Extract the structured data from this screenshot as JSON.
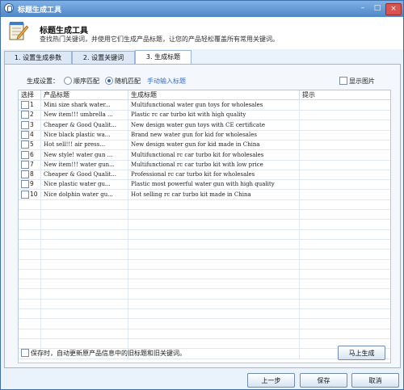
{
  "window": {
    "title": "标题生成工具"
  },
  "titlebar_buttons": {
    "minimize": "–",
    "maximize": "□",
    "close": "×"
  },
  "header": {
    "title": "标题生成工具",
    "subtitle": "查找热门关键词，并使用它们生成产品标题，让您的产品轻松覆盖所有常用关键词。"
  },
  "tabs": [
    {
      "label": "1. 设置生成参数",
      "active": false
    },
    {
      "label": "2. 设置关键词",
      "active": false
    },
    {
      "label": "3. 生成标题",
      "active": true
    }
  ],
  "settings": {
    "label": "生成设置：",
    "option_sequential": "顺序匹配",
    "option_random": "随机匹配",
    "selected": "random",
    "manual_link": "手动输入标题",
    "show_image": "显示图片"
  },
  "table": {
    "headers": [
      "选择",
      "产品标题",
      "生成标题",
      "提示"
    ],
    "rows": [
      {
        "num": "1",
        "product": "Mini size shark water...",
        "generated": "Multifunctional water gun toys for wholesales"
      },
      {
        "num": "2",
        "product": "New item!!! umbrella ...",
        "generated": "Plastic rc car turbo kit with high quality"
      },
      {
        "num": "3",
        "product": "Cheaper & Good Qualit...",
        "generated": "New design water gun toys with CE certificate"
      },
      {
        "num": "4",
        "product": "Nice black plastic wa...",
        "generated": "Brand new water gun for kid for wholesales"
      },
      {
        "num": "5",
        "product": "Hot sell!!! air press...",
        "generated": "New design water gun for kid made in China"
      },
      {
        "num": "6",
        "product": "New style! water gun ...",
        "generated": "Multifunctional rc car turbo kit for wholesales"
      },
      {
        "num": "7",
        "product": "New item!!! water gun...",
        "generated": "Multifunctional rc car turbo kit with low price"
      },
      {
        "num": "8",
        "product": "Cheaper & Good Qualit...",
        "generated": "Professional rc car turbo kit for wholesales"
      },
      {
        "num": "9",
        "product": "Nice plastic water gu...",
        "generated": "Plastic most powerful water gun with high quality"
      },
      {
        "num": "10",
        "product": "Nice dolphin water gu...",
        "generated": "Hot selling rc car turbo kit made in China"
      }
    ]
  },
  "save_option": "保存时，自动更新原产品信息中的旧标题和旧关键词。",
  "buttons": {
    "generate": "马上生成",
    "prev": "上一步",
    "save": "保存",
    "cancel": "取消"
  }
}
